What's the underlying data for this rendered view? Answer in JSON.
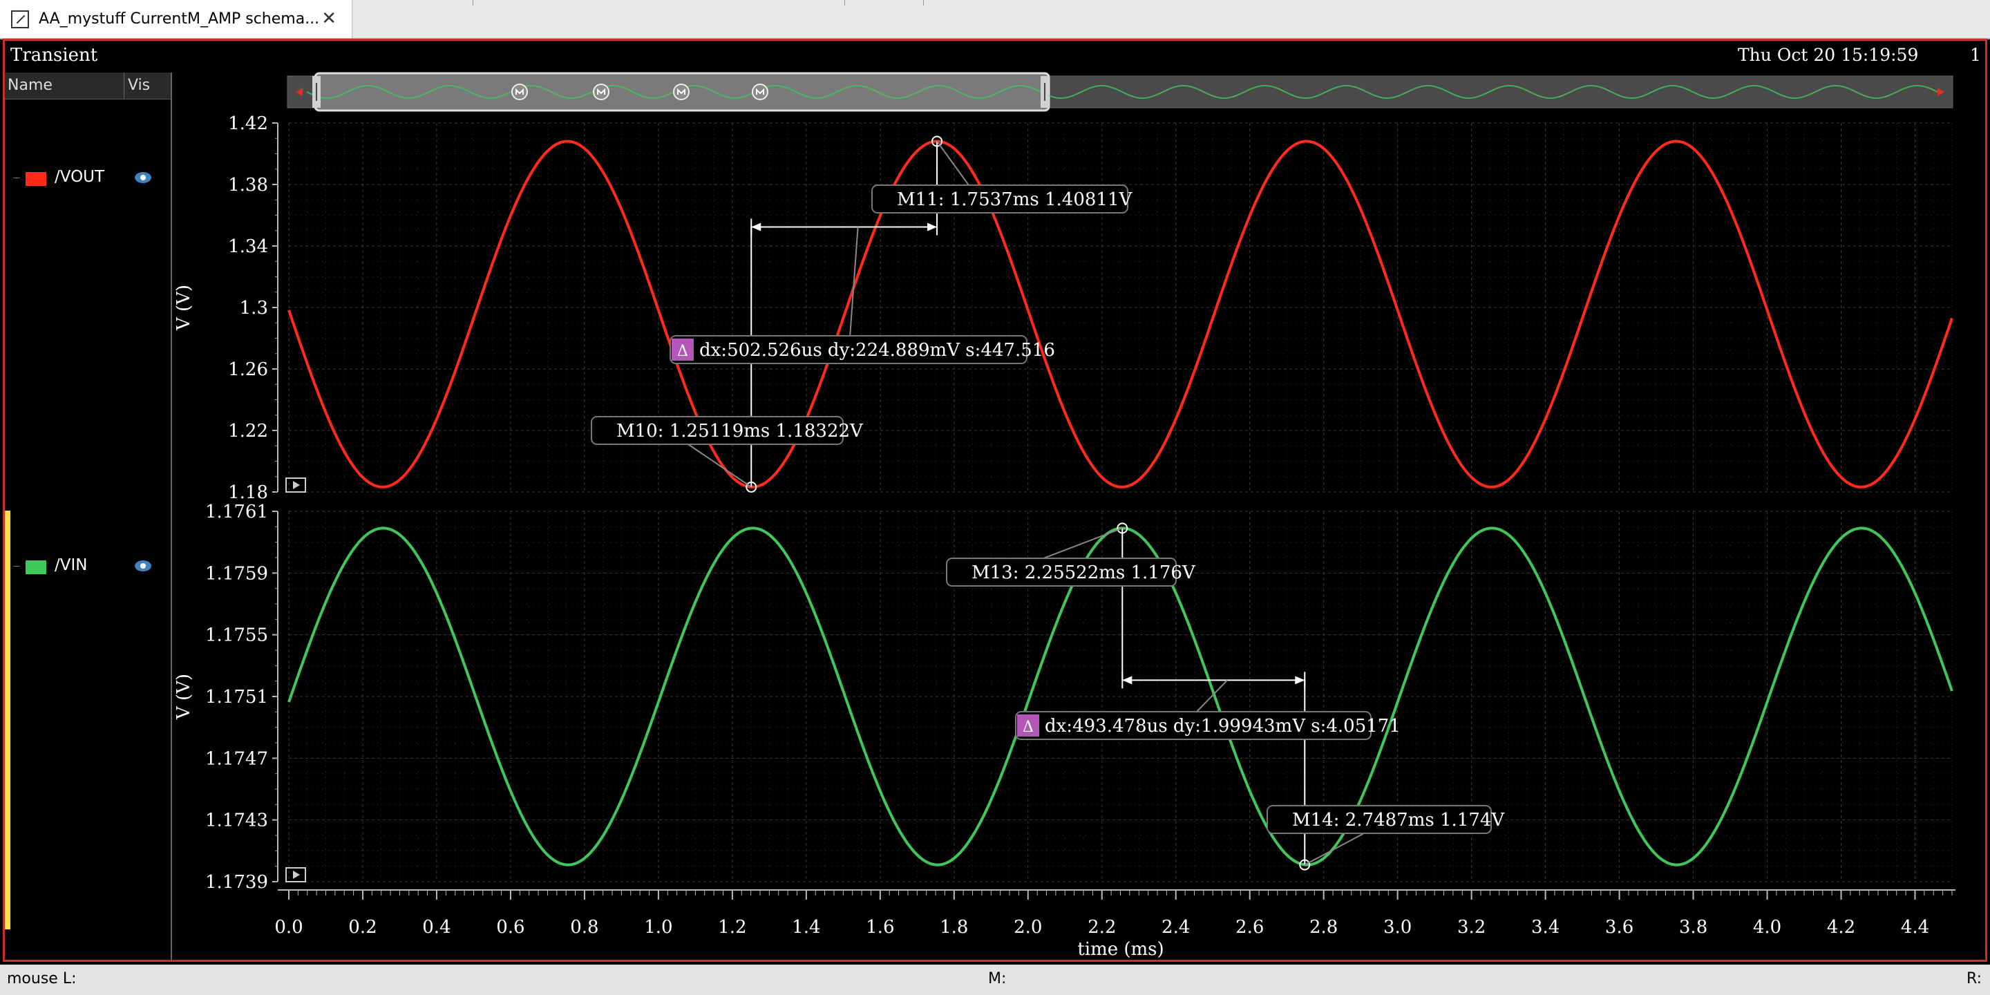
{
  "window": {
    "tab_title": "AA_mystuff CurrentM_AMP schema...",
    "close_glyph": "✕"
  },
  "graph": {
    "analysis": "Transient",
    "date": "Thu Oct 20 15:19:59",
    "subwindow_number": "1"
  },
  "legend": {
    "col_name": "Name",
    "col_vis": "Vis",
    "items": [
      {
        "name": "/VOUT",
        "color": "#ff2a1a"
      },
      {
        "name": "/VIN",
        "color": "#3ec85a"
      }
    ]
  },
  "status_bar": {
    "mouse_l": "mouse L:",
    "m": "M:",
    "r": "R:"
  },
  "chart_data": [
    {
      "type": "line",
      "title": "",
      "xlabel": "time (ms)",
      "ylabel": "V (V)",
      "xlim": [
        0,
        4.5
      ],
      "ylim": [
        1.18,
        1.42
      ],
      "yticks": [
        "1.42",
        "1.38",
        "1.34",
        "1.3",
        "1.26",
        "1.22",
        "1.18"
      ],
      "grid": true,
      "series": [
        {
          "name": "/VOUT",
          "color": "#ff2a1a",
          "waveform": "sine",
          "period_ms": 1.0,
          "phase_peak_ms": 0.7537,
          "min": 1.18322,
          "max": 1.40811
        }
      ],
      "markers": [
        {
          "label": "M11: 1.7537ms 1.40811V",
          "x": 1.7537,
          "y": 1.40811
        },
        {
          "label": "M10: 1.25119ms 1.18322V",
          "x": 1.25119,
          "y": 1.18322
        }
      ],
      "delta": {
        "label": "dx:502.526us dy:224.889mV s:447.516",
        "from": [
          1.25119,
          1.18322
        ],
        "to": [
          1.7537,
          1.40811
        ]
      }
    },
    {
      "type": "line",
      "title": "",
      "xlabel": "time (ms)",
      "ylabel": "V (V)",
      "xlim": [
        0,
        4.5
      ],
      "ylim": [
        1.1739,
        1.1761
      ],
      "yticks": [
        "1.1761",
        "1.1759",
        "1.1755",
        "1.1751",
        "1.1747",
        "1.1743",
        "1.1739"
      ],
      "xticks": [
        "0.0",
        "0.2",
        "0.4",
        "0.6",
        "0.8",
        "1.0",
        "1.2",
        "1.4",
        "1.6",
        "1.8",
        "2.0",
        "2.2",
        "2.4",
        "2.6",
        "2.8",
        "3.0",
        "3.2",
        "3.4",
        "3.6",
        "3.8",
        "4.0",
        "4.2",
        "4.4"
      ],
      "grid": true,
      "series": [
        {
          "name": "/VIN",
          "color": "#3ec85a",
          "waveform": "sine",
          "period_ms": 1.0,
          "phase_peak_ms": 0.25522,
          "min": 1.174,
          "max": 1.176
        }
      ],
      "markers": [
        {
          "label": "M13: 2.25522ms 1.176V",
          "x": 2.25522,
          "y": 1.176
        },
        {
          "label": "M14: 2.7487ms 1.174V",
          "x": 2.7487,
          "y": 1.174
        }
      ],
      "delta": {
        "label": "dx:493.478us dy:1.99943mV s:4.05171",
        "from": [
          2.25522,
          1.176
        ],
        "to": [
          2.7487,
          1.174
        ]
      }
    }
  ]
}
